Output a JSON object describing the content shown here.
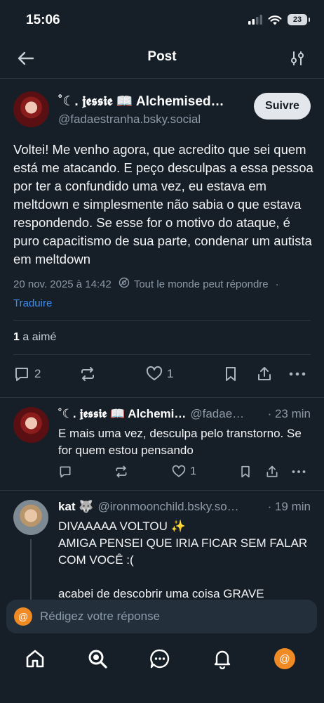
{
  "status_bar": {
    "time": "15:06",
    "battery": "23"
  },
  "header": {
    "title": "Post"
  },
  "main_post": {
    "author_name": "˚☾. 𝖏𝖊𝖘𝖘𝖎𝖊 📖 Alchemised…",
    "author_handle": "@fadaestranha.bsky.social",
    "follow_label": "Suivre",
    "text": "Voltei! Me venho agora, que acredito que sei quem está me atacando. E peço desculpas a essa pessoa por ter a confundido uma vez, eu estava em meltdown e simplesmente não sabia o que estava respondendo. Se esse for o motivo do ataque, é puro capacitismo de sua parte, condenar um autista em meltdown",
    "timestamp": "20 nov. 2025 à 14:42",
    "reply_permission": "Tout le monde peut répondre",
    "meta_dot": "·",
    "translate_label": "Traduire",
    "likes_count": "1",
    "likes_label": "a aimé",
    "reply_count": "2",
    "like_count": "1"
  },
  "replies": [
    {
      "author_name": "˚☾. 𝖏𝖊𝖘𝖘𝖎𝖊 📖 Alchemi…",
      "handle": "@fadae…",
      "time": "· 23 min",
      "text": "E mais uma vez, desculpa pelo transtorno. Se for quem estou pensando",
      "like_count": "1"
    },
    {
      "author_name": "kat 🐺",
      "handle": "@ironmoonchild.bsky.so…",
      "time": "· 19 min",
      "text": "DIVAAAAA VOLTOU ✨\nAMIGA PENSEI QUE IRIA FICAR SEM FALAR COM VOCÊ :(\n\nacabei de descobrir uma coisa GRAVE"
    }
  ],
  "composer": {
    "placeholder": "Rédigez votre réponse",
    "avatar_glyph": "@"
  },
  "nav": {
    "profile_glyph": "@"
  },
  "colors": {
    "background": "#161e27",
    "accent": "#3b8ef5",
    "avatar_orange": "#f08a24"
  }
}
